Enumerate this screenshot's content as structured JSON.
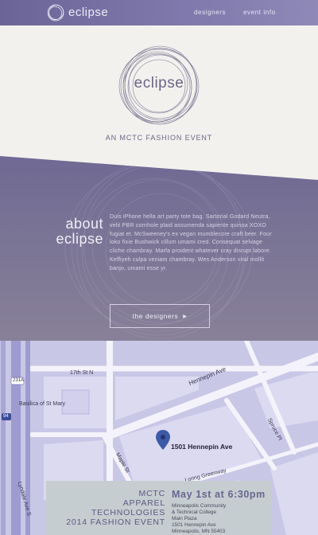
{
  "nav": {
    "logo_text": "eclipse",
    "links": [
      {
        "label": "designers"
      },
      {
        "label": "event info"
      }
    ]
  },
  "hero": {
    "logo_text": "eclipse",
    "tagline": "AN MCTC FASHION EVENT"
  },
  "about": {
    "title_line1": "about",
    "title_line2": "eclipse",
    "body": "Duis iPhone hella art party tote bag. Sartorial Godard Neutra, velit PBR cornhole plaid assumenda sapiente quinoa XOXO fugiat et. McSweeney's ex vegan mumblecore craft beer. Four loko fixie Bushwick cillum umami cred. Consequat selvage cliche chambray. Marfa proident whatever cray disrupt labore. Keffiyeh culpa veniam chambray. Wes Anderson viral mollit banjo, umami esse yr.",
    "button_label": "the designers",
    "button_icon": "caret-right-icon"
  },
  "map": {
    "labels": {
      "street_17th": "17th St N",
      "hennepin": "Hennepin Ave",
      "basilica": "Basilica of St Mary",
      "spruce": "Spruce Pl",
      "maple": "Maple St",
      "loring": "Loring Greenway",
      "lyndale": "Lyndale Ave S",
      "hwy94": "94",
      "hwy231": "231A"
    },
    "pin_label": "1501 Hennepin Ave"
  },
  "event": {
    "name_lines": [
      "MCTC",
      "APPAREL",
      "TECHNOLOGIES",
      "2014 FASHION EVENT"
    ],
    "date": "May 1st at 6:30pm",
    "address_lines": [
      "Minneapolis Community",
      "& Technical College",
      "Main Plaza",
      "1501 Hennepin Ave",
      "Minneapolis, MN 55403"
    ]
  },
  "colors": {
    "nav": "#7e78ab",
    "accent": "#6b6591",
    "about_bg": "#7a7495",
    "map_bg": "#c9c7e6",
    "event_card": "#c5cdd1"
  }
}
